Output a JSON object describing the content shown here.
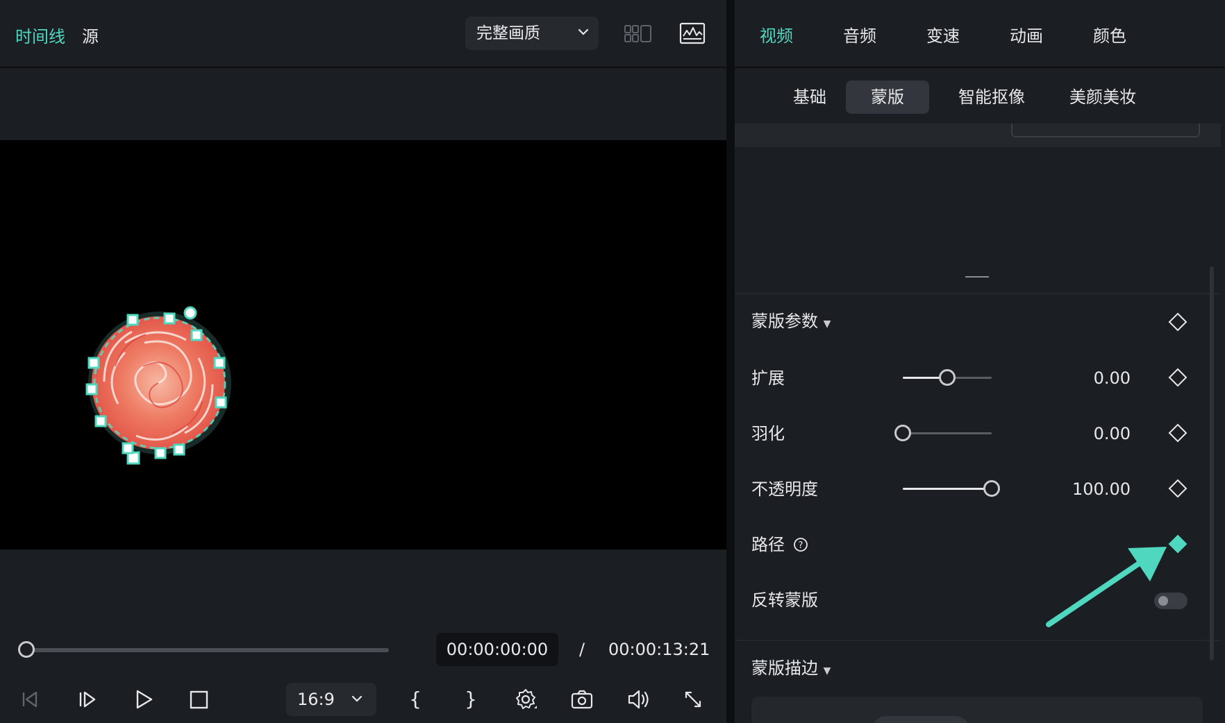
{
  "left_header": {
    "tab_timeline": "时间线",
    "tab_source": "源",
    "quality_label": "完整画质"
  },
  "player": {
    "current_time": "00:00:00:00",
    "separator": "/",
    "total_time": "00:00:13:21",
    "aspect_ratio": "16:9"
  },
  "right_tabs": {
    "items": [
      "视频",
      "音频",
      "变速",
      "动画",
      "颜色"
    ],
    "active": "视频"
  },
  "sub_tabs": {
    "items": [
      "基础",
      "蒙版",
      "智能抠像",
      "美颜美妆"
    ],
    "active": "蒙版"
  },
  "mask_params": {
    "title": "蒙版参数",
    "expand": {
      "label": "扩展",
      "value": "0.00",
      "level": 0.5
    },
    "feather": {
      "label": "羽化",
      "value": "0.00",
      "level": 0.0
    },
    "opacity": {
      "label": "不透明度",
      "value": "100.00",
      "level": 1.0
    },
    "path_label": "路径",
    "invert_label": "反转蒙版",
    "invert_on": false
  },
  "mask_stroke": {
    "title": "蒙版描边"
  },
  "colors": {
    "accent": "#4fd8bf",
    "panel": "#1b1e22",
    "video_bg": "#000000"
  }
}
